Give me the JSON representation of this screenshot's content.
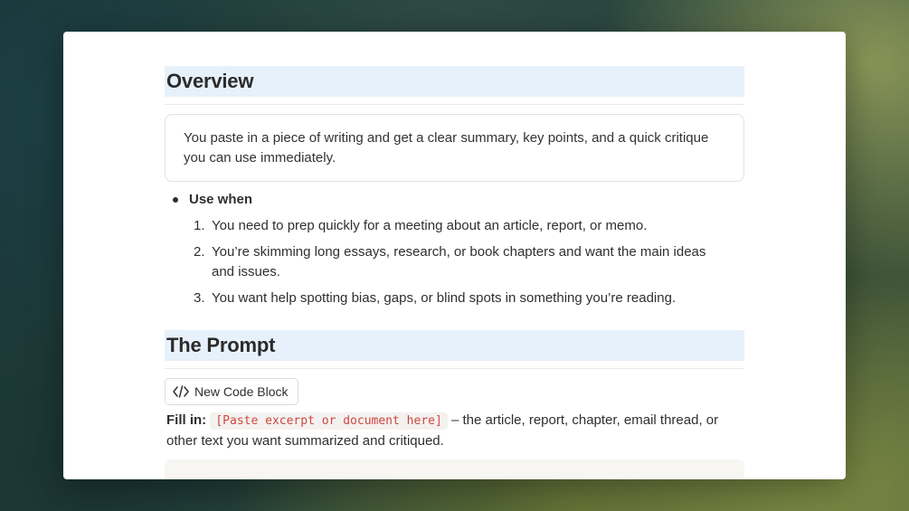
{
  "overview": {
    "heading": "Overview",
    "callout_text": "You paste in a piece of writing and get a clear summary, key points, and a quick critique you can use immediately."
  },
  "use_when": {
    "label": "Use when",
    "items": [
      {
        "num": "1.",
        "text": "You need to prep quickly for a meeting about an article, report, or memo."
      },
      {
        "num": "2.",
        "text": "You’re skimming long essays, research, or book chapters and want the main ideas and issues."
      },
      {
        "num": "3.",
        "text": "You want help spotting bias, gaps, or blind spots in something you’re reading."
      }
    ]
  },
  "prompt": {
    "heading": "The Prompt",
    "code_button_label": "New Code Block",
    "code_button_icon": "code-brackets-icon",
    "fill_label": "Fill in:",
    "fill_placeholder": "[Paste excerpt or document here]",
    "fill_description": " – the article, report, chapter, email thread, or other text you want summarized and critiqued."
  },
  "colors": {
    "heading_bg": "#e7f1fb",
    "inline_code_text": "#d0463e",
    "inline_code_bg": "#f3f2f0"
  }
}
